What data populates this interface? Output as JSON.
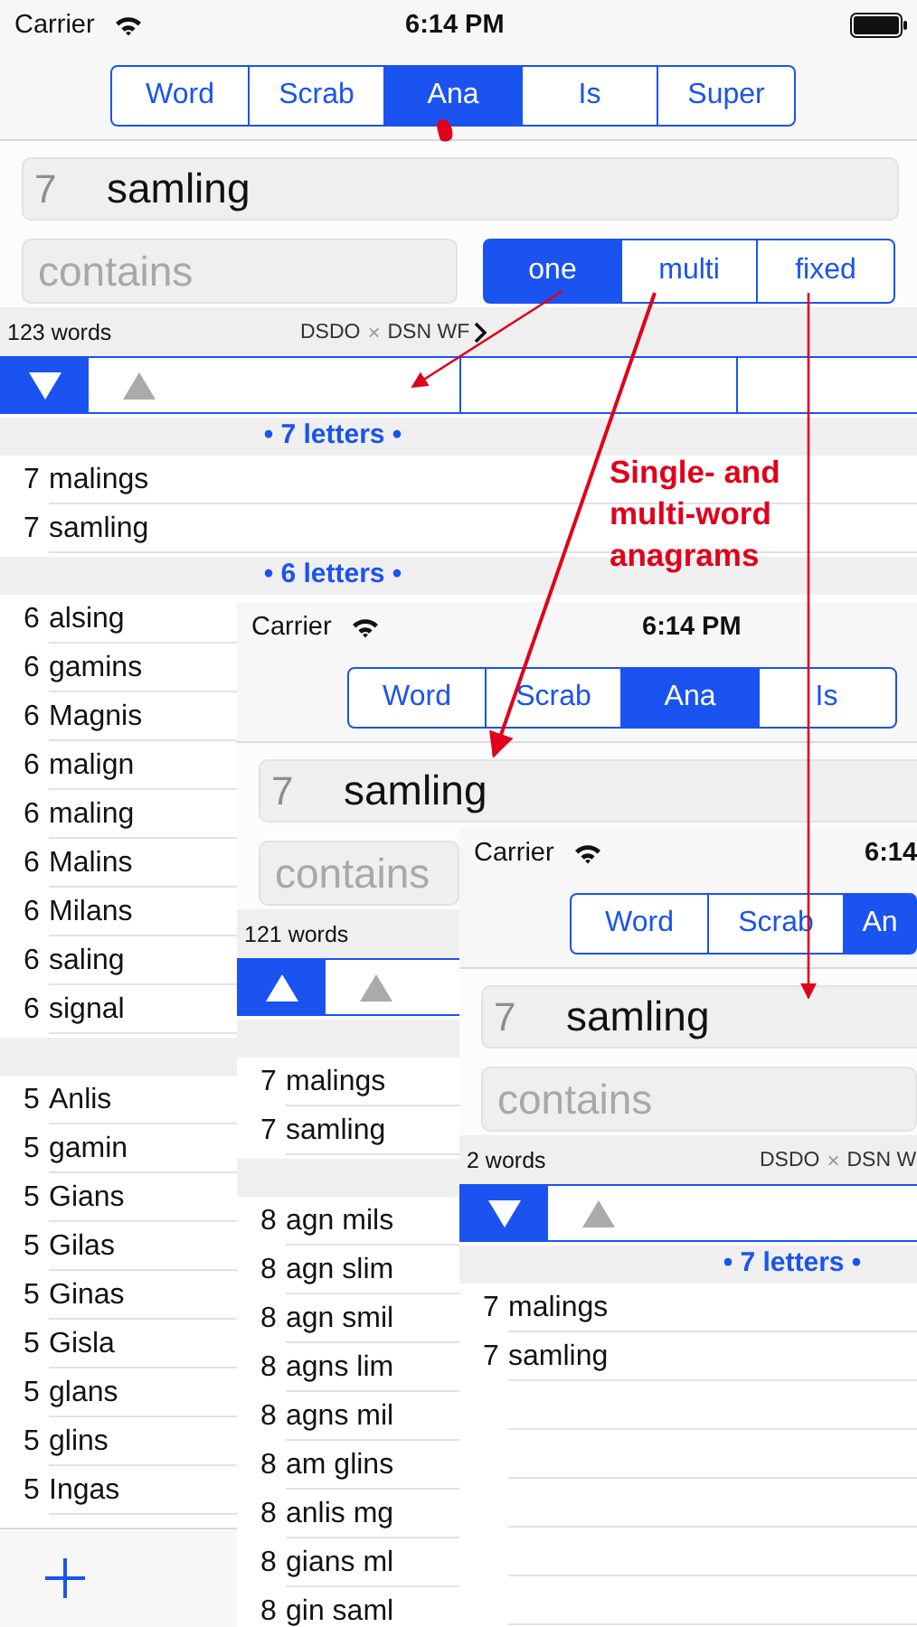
{
  "screens": [
    {
      "status": {
        "carrier": "Carrier",
        "time": "6:14 PM",
        "battery": true
      },
      "tabs": [
        {
          "label": "Word",
          "selected": false
        },
        {
          "label": "Scrab",
          "selected": false
        },
        {
          "label": "Ana",
          "selected": true
        },
        {
          "label": "Is",
          "selected": false
        },
        {
          "label": "Super",
          "selected": false
        }
      ],
      "query": {
        "length": "7",
        "value": "samling"
      },
      "contains": {
        "placeholder": "contains"
      },
      "modes": [
        {
          "label": "one",
          "selected": true
        },
        {
          "label": "multi",
          "selected": false
        },
        {
          "label": "fixed",
          "selected": false
        }
      ],
      "summary": {
        "count": "123 words",
        "dictionary": "DSDO",
        "remove": "×",
        "word_list": "DSN WF",
        "more": true
      },
      "sort": [
        {
          "kind": "down",
          "selected": true
        },
        {
          "kind": "up",
          "selected": false
        }
      ],
      "sections": [
        {
          "header": "• 7 letters •",
          "rows": [
            {
              "length": "7",
              "word": "malings"
            },
            {
              "length": "7",
              "word": "samling"
            }
          ]
        },
        {
          "header": "• 6 letters •",
          "rows": [
            {
              "length": "6",
              "word": "alsing"
            },
            {
              "length": "6",
              "word": "gamins"
            },
            {
              "length": "6",
              "word": "Magnis"
            },
            {
              "length": "6",
              "word": "malign"
            },
            {
              "length": "6",
              "word": "maling"
            },
            {
              "length": "6",
              "word": "Malins"
            },
            {
              "length": "6",
              "word": "Milans"
            },
            {
              "length": "6",
              "word": "saling"
            },
            {
              "length": "6",
              "word": "signal"
            }
          ]
        },
        {
          "rows": [
            {
              "length": "5",
              "word": "Anlis"
            },
            {
              "length": "5",
              "word": "gamin"
            },
            {
              "length": "5",
              "word": "Gians"
            },
            {
              "length": "5",
              "word": "Gilas"
            },
            {
              "length": "5",
              "word": "Ginas"
            },
            {
              "length": "5",
              "word": "Gisla"
            },
            {
              "length": "5",
              "word": "glans"
            },
            {
              "length": "5",
              "word": "glins"
            },
            {
              "length": "5",
              "word": "Ingas"
            }
          ]
        }
      ],
      "toolbar": true
    },
    {
      "status": {
        "carrier": "Carrier",
        "time": "6:14 PM"
      },
      "tabs": [
        {
          "label": "Word",
          "selected": false
        },
        {
          "label": "Scrab",
          "selected": false
        },
        {
          "label": "Ana",
          "selected": true
        },
        {
          "label": "Is",
          "selected": false
        }
      ],
      "query": {
        "length": "7",
        "value": "samling"
      },
      "contains": {
        "placeholder": "contains"
      },
      "summary": {
        "count": "121 words"
      },
      "sort": [
        {
          "kind": "up",
          "selected": true
        },
        {
          "kind": "up",
          "selected": false
        }
      ],
      "sections": [
        {
          "rows": [
            {
              "length": "7",
              "word": "malings"
            },
            {
              "length": "7",
              "word": "samling"
            }
          ]
        },
        {
          "rows": [
            {
              "length": "8",
              "word": "agn mils"
            },
            {
              "length": "8",
              "word": "agn slim"
            },
            {
              "length": "8",
              "word": "agn smil"
            },
            {
              "length": "8",
              "word": "agns lim"
            },
            {
              "length": "8",
              "word": "agns mil"
            },
            {
              "length": "8",
              "word": "am glins"
            },
            {
              "length": "8",
              "word": "anlis mg"
            },
            {
              "length": "8",
              "word": "gians ml"
            },
            {
              "length": "8",
              "word": "gin saml"
            }
          ]
        }
      ]
    },
    {
      "status": {
        "carrier": "Carrier",
        "time": "6:14"
      },
      "tabs": [
        {
          "label": "Word",
          "selected": false
        },
        {
          "label": "Scrab",
          "selected": false
        },
        {
          "label": "An",
          "selected": true
        }
      ],
      "query": {
        "length": "7",
        "value": "samling"
      },
      "contains": {
        "placeholder": "contains"
      },
      "summary": {
        "count": "2 words",
        "dictionary": "DSDO",
        "remove": "×",
        "word_list": "DSN W"
      },
      "sort": [
        {
          "kind": "down",
          "selected": true
        },
        {
          "kind": "up",
          "selected": false
        }
      ],
      "sections": [
        {
          "header": "• 7 letters •",
          "rows": [
            {
              "length": "7",
              "word": "malings"
            },
            {
              "length": "7",
              "word": "samling"
            }
          ]
        }
      ]
    }
  ],
  "annotation": {
    "text": "Single- and multi-word anagrams"
  }
}
